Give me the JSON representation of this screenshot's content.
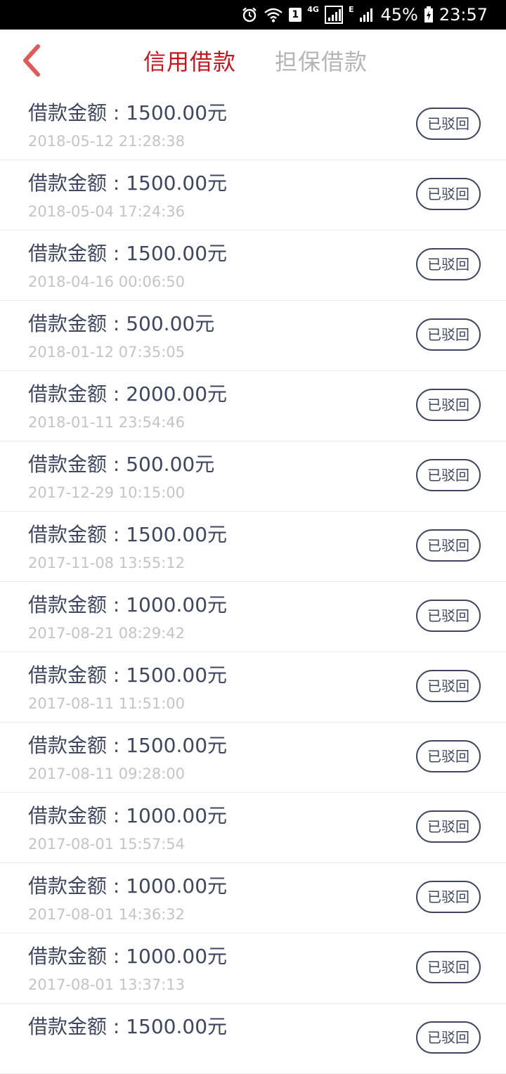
{
  "status_bar": {
    "sim_label": "1",
    "lte_label": "4G",
    "edge_label": "E",
    "battery_percent": "45%",
    "time": "23:57",
    "icons": [
      "alarm-icon",
      "wifi-icon",
      "sim-icon",
      "signal-icon",
      "battery-icon"
    ]
  },
  "header": {
    "back_icon": "chevron-left-icon",
    "tabs": [
      {
        "label": "信用借款",
        "active": true
      },
      {
        "label": "担保借款",
        "active": false
      }
    ]
  },
  "colors": {
    "accent": "#c9161d",
    "text_primary": "#3e4660",
    "text_secondary": "#c4c4c4",
    "tab_inactive": "#b5b5b5"
  },
  "loans": [
    {
      "amount_label": "借款金额 : 1500.00元",
      "date": "2018-05-12 21:28:38",
      "status": "已驳回"
    },
    {
      "amount_label": "借款金额 : 1500.00元",
      "date": "2018-05-04 17:24:36",
      "status": "已驳回"
    },
    {
      "amount_label": "借款金额 : 1500.00元",
      "date": "2018-04-16 00:06:50",
      "status": "已驳回"
    },
    {
      "amount_label": "借款金额 : 500.00元",
      "date": "2018-01-12 07:35:05",
      "status": "已驳回"
    },
    {
      "amount_label": "借款金额 : 2000.00元",
      "date": "2018-01-11 23:54:46",
      "status": "已驳回"
    },
    {
      "amount_label": "借款金额 : 500.00元",
      "date": "2017-12-29 10:15:00",
      "status": "已驳回"
    },
    {
      "amount_label": "借款金额 : 1500.00元",
      "date": "2017-11-08 13:55:12",
      "status": "已驳回"
    },
    {
      "amount_label": "借款金额 : 1000.00元",
      "date": "2017-08-21 08:29:42",
      "status": "已驳回"
    },
    {
      "amount_label": "借款金额 : 1500.00元",
      "date": "2017-08-11 11:51:00",
      "status": "已驳回"
    },
    {
      "amount_label": "借款金额 : 1500.00元",
      "date": "2017-08-11 09:28:00",
      "status": "已驳回"
    },
    {
      "amount_label": "借款金额 : 1000.00元",
      "date": "2017-08-01 15:57:54",
      "status": "已驳回"
    },
    {
      "amount_label": "借款金额 : 1000.00元",
      "date": "2017-08-01 14:36:32",
      "status": "已驳回"
    },
    {
      "amount_label": "借款金额 : 1000.00元",
      "date": "2017-08-01 13:37:13",
      "status": "已驳回"
    },
    {
      "amount_label": "借款金额 : 1500.00元",
      "date": "",
      "status": "已驳回"
    }
  ]
}
